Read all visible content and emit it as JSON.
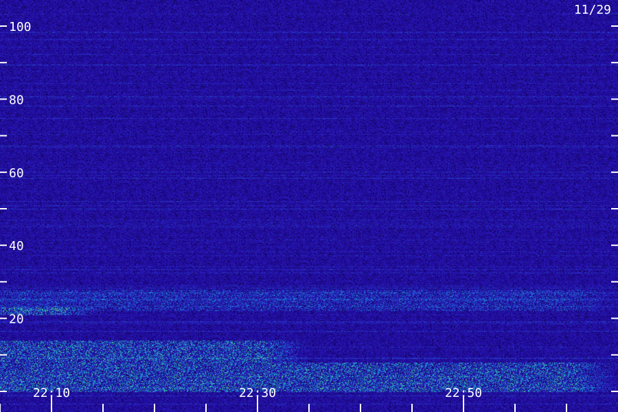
{
  "chart_data": {
    "type": "heatmap",
    "title": "",
    "xlabel": "",
    "ylabel": "",
    "date_label": "11/29",
    "x_range": [
      "22:05",
      "23:05"
    ],
    "ylim": [
      0,
      100
    ],
    "y_ticks": [
      20,
      40,
      60,
      80,
      100
    ],
    "y_minor_ticks": [
      0,
      10,
      30,
      50,
      70,
      90
    ],
    "x_ticks": [
      "22:10",
      "22:30",
      "22:50"
    ],
    "x_minor_ticks": [
      "22:05",
      "22:15",
      "22:20",
      "22:25",
      "22:35",
      "22:40",
      "22:45",
      "22:55",
      "23:00"
    ],
    "colormap": [
      "#000010",
      "#14006e",
      "#2a15b8",
      "#1a6fd6",
      "#1fc0c0",
      "#9af04a"
    ],
    "activity_bands": [
      {
        "freq_range": [
          0,
          8
        ],
        "from": "22:05",
        "to": "23:05",
        "level": "high"
      },
      {
        "freq_range": [
          8,
          14
        ],
        "from": "22:05",
        "to": "22:35",
        "level": "high"
      },
      {
        "freq_range": [
          21,
          23
        ],
        "from": "22:05",
        "to": "22:15",
        "level": "high"
      },
      {
        "freq_range": [
          22,
          28
        ],
        "from": "22:05",
        "to": "23:05",
        "level": "medium"
      }
    ],
    "grid": false,
    "legend": "none"
  }
}
